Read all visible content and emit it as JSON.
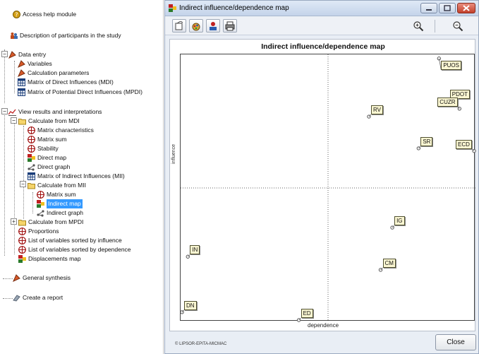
{
  "tree": {
    "items": [
      {
        "label": "Access help module"
      },
      {
        "label": "Description of participants in the study"
      },
      {
        "label": "Data entry"
      },
      {
        "label": "Variables"
      },
      {
        "label": "Calculation parameters"
      },
      {
        "label": "Matrix of Direct Influences (MDI)"
      },
      {
        "label": "Matrix of Potential Direct Influences (MPDI)"
      },
      {
        "label": "View results and interpretations"
      },
      {
        "label": "Calculate from MDI"
      },
      {
        "label": "Matrix characteristics"
      },
      {
        "label": "Matrix sum"
      },
      {
        "label": "Stability"
      },
      {
        "label": "Direct map"
      },
      {
        "label": "Direct graph"
      },
      {
        "label": "Matrix of Indirect Influences (MII)"
      },
      {
        "label": "Calculate from MII"
      },
      {
        "label": "Matrix sum"
      },
      {
        "label": "Indirect map"
      },
      {
        "label": "Indirect graph"
      },
      {
        "label": "Calculate from MPDI"
      },
      {
        "label": "Proportions"
      },
      {
        "label": "List of variables sorted by influence"
      },
      {
        "label": "List of variables sorted by dependence"
      },
      {
        "label": "Displacements map"
      },
      {
        "label": "General synthesis"
      },
      {
        "label": "Create a report"
      }
    ]
  },
  "window": {
    "title": "Indirect influence/dependence map",
    "chart_title": "Indirect influence/dependence map",
    "copyright": "© LIPSOR-EPITA-MICMAC",
    "close_label": "Close"
  },
  "colors": {
    "selection": "#3399ff",
    "label_bg": "#fbf7d2",
    "titlebar": "#c4d4ea"
  },
  "chart_data": {
    "type": "scatter",
    "title": "Indirect influence/dependence map",
    "xlabel": "dependence",
    "ylabel": "influence",
    "xlim": [
      0,
      100
    ],
    "ylim": [
      0,
      100
    ],
    "grid": "center cross (dotted)",
    "points": [
      {
        "label": "PUOS",
        "x": 88,
        "y": 99
      },
      {
        "label": "PDOT",
        "x": 91,
        "y": 83
      },
      {
        "label": "CUZR",
        "x": 95,
        "y": 80
      },
      {
        "label": "RV",
        "x": 64,
        "y": 77
      },
      {
        "label": "SR",
        "x": 81,
        "y": 65
      },
      {
        "label": "ECD",
        "x": 100,
        "y": 64
      },
      {
        "label": "IG",
        "x": 72,
        "y": 35
      },
      {
        "label": "CM",
        "x": 68,
        "y": 19
      },
      {
        "label": "IN",
        "x": 2,
        "y": 24
      },
      {
        "label": "DN",
        "x": 0,
        "y": 3
      },
      {
        "label": "ED",
        "x": 40,
        "y": 0
      }
    ]
  }
}
